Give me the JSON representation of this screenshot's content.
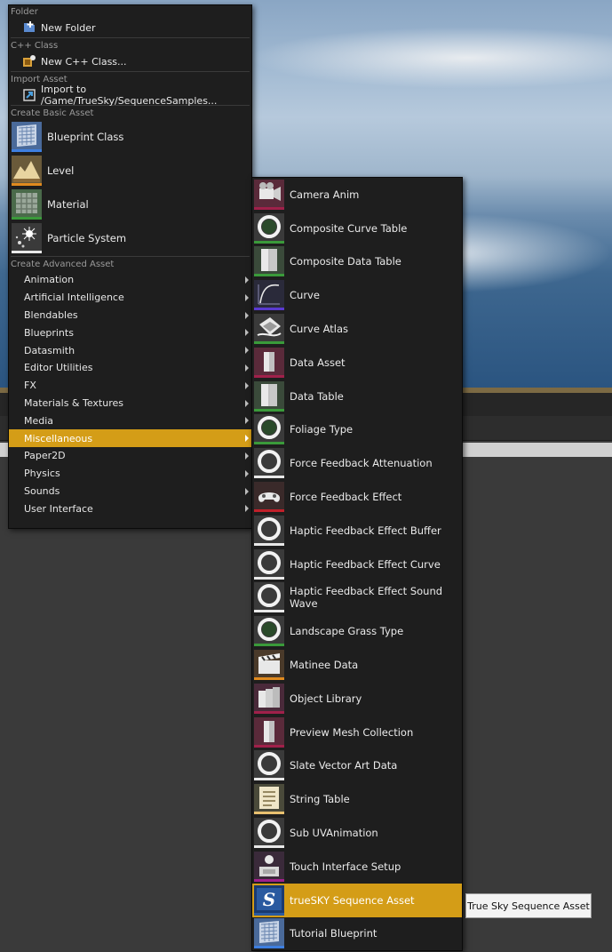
{
  "main_menu": {
    "sections": {
      "folder": "Folder",
      "cpp": "C++ Class",
      "import": "Import Asset",
      "basic": "Create Basic Asset",
      "advanced": "Create Advanced Asset"
    },
    "new_folder": "New Folder",
    "new_cpp": "New C++ Class...",
    "import_to": "Import to /Game/TrueSky/SequenceSamples...",
    "basic_assets": [
      {
        "label": "Blueprint Class",
        "icon": "blueprint-icon",
        "color": "#3e7fe0"
      },
      {
        "label": "Level",
        "icon": "level-icon",
        "color": "#e08a1e"
      },
      {
        "label": "Material",
        "icon": "material-icon",
        "color": "#3a9a3a"
      },
      {
        "label": "Particle System",
        "icon": "particle-icon",
        "color": "#e8e8e8"
      }
    ],
    "advanced_assets": [
      "Animation",
      "Artificial Intelligence",
      "Blendables",
      "Blueprints",
      "Datasmith",
      "Editor Utilities",
      "FX",
      "Materials & Textures",
      "Media",
      "Miscellaneous",
      "Paper2D",
      "Physics",
      "Sounds",
      "User Interface"
    ],
    "active_index": 9
  },
  "sub_menu": {
    "items": [
      {
        "label": "Camera Anim",
        "icon": "camera-anim-icon",
        "color": "#a0204a"
      },
      {
        "label": "Composite Curve Table",
        "icon": "ring-icon",
        "color": "#3a9a3a"
      },
      {
        "label": "Composite Data Table",
        "icon": "data-table-icon",
        "color": "#3a9a3a"
      },
      {
        "label": "Curve",
        "icon": "curve-icon",
        "color": "#5a3ad0"
      },
      {
        "label": "Curve Atlas",
        "icon": "curve-atlas-icon",
        "color": "#3a9a3a"
      },
      {
        "label": "Data Asset",
        "icon": "data-asset-icon",
        "color": "#a0204a"
      },
      {
        "label": "Data Table",
        "icon": "data-table-icon",
        "color": "#3a9a3a"
      },
      {
        "label": "Foliage Type",
        "icon": "ring-icon",
        "color": "#3a9a3a"
      },
      {
        "label": "Force Feedback Attenuation",
        "icon": "ring-icon",
        "color": "#e8e8e8"
      },
      {
        "label": "Force Feedback Effect",
        "icon": "gamepad-icon",
        "color": "#c0202a"
      },
      {
        "label": "Haptic Feedback Effect Buffer",
        "icon": "ring-icon",
        "color": "#e8e8e8"
      },
      {
        "label": "Haptic Feedback Effect Curve",
        "icon": "ring-icon",
        "color": "#e8e8e8"
      },
      {
        "label": "Haptic Feedback Effect Sound Wave",
        "icon": "ring-icon",
        "color": "#e8e8e8"
      },
      {
        "label": "Landscape Grass Type",
        "icon": "ring-icon",
        "color": "#3a9a3a"
      },
      {
        "label": "Matinee Data",
        "icon": "clapperboard-icon",
        "color": "#e08a1e"
      },
      {
        "label": "Object Library",
        "icon": "object-library-icon",
        "color": "#a0204a"
      },
      {
        "label": "Preview Mesh Collection",
        "icon": "preview-mesh-icon",
        "color": "#a0204a"
      },
      {
        "label": "Slate Vector Art Data",
        "icon": "ring-icon",
        "color": "#e8e8e8"
      },
      {
        "label": "String Table",
        "icon": "string-table-icon",
        "color": "#e8c070"
      },
      {
        "label": "Sub UVAnimation",
        "icon": "ring-icon",
        "color": "#e8e8e8"
      },
      {
        "label": "Touch Interface Setup",
        "icon": "touch-interface-icon",
        "color": "#a0208a"
      },
      {
        "label": "trueSKY Sequence Asset",
        "icon": "truesky-icon",
        "color": "#2a5aa0"
      },
      {
        "label": "Tutorial Blueprint",
        "icon": "blueprint-icon",
        "color": "#3e7fe0"
      }
    ],
    "active_index": 21
  },
  "tooltip": "True Sky Sequence Asset"
}
